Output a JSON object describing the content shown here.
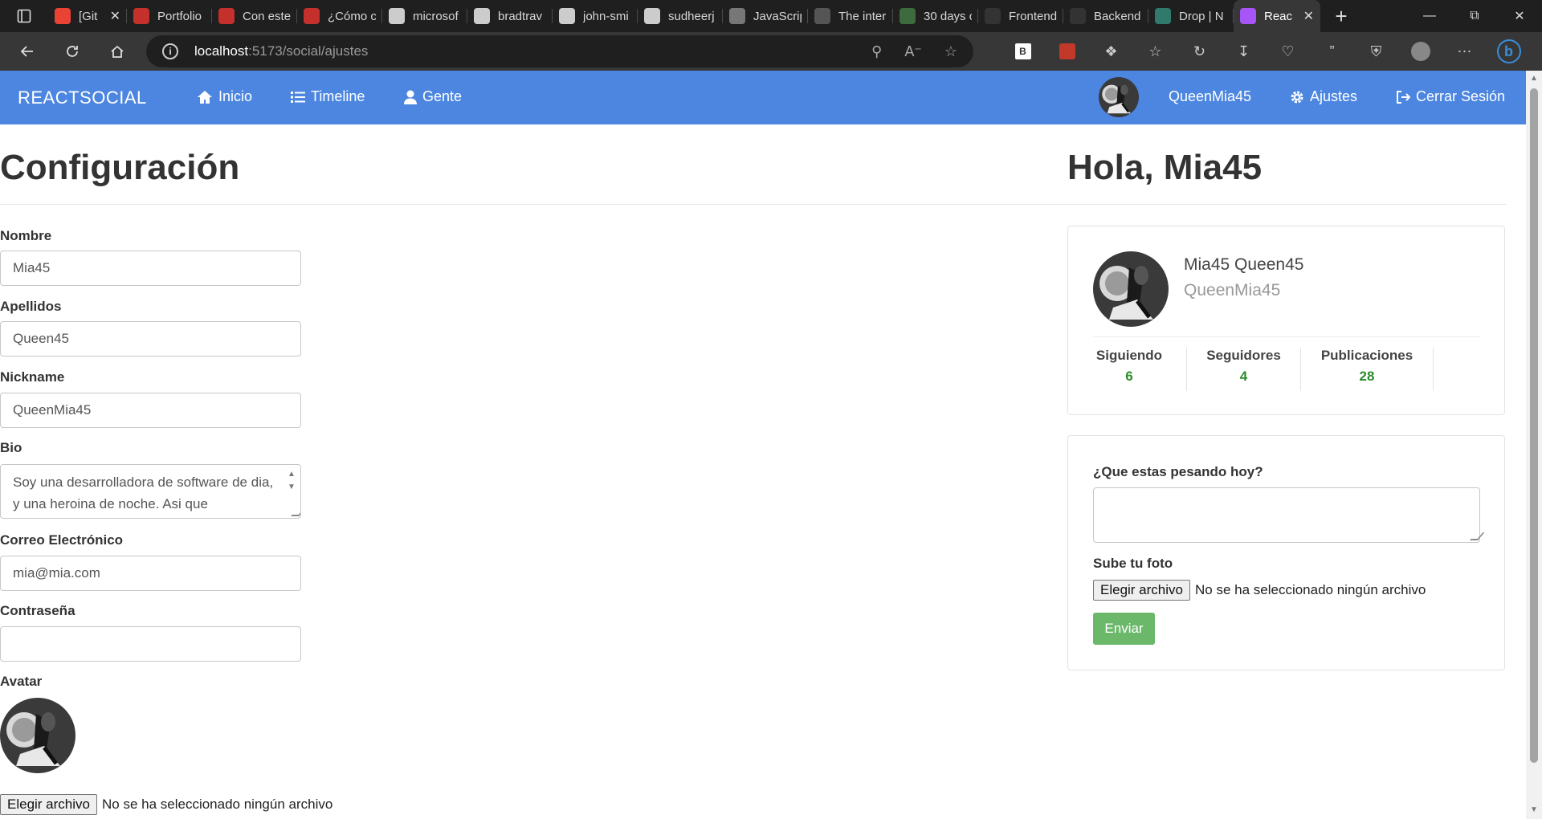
{
  "browser": {
    "tabs": [
      {
        "label": "[Git",
        "icon": "gmail-icon",
        "color": "#ea4335"
      },
      {
        "label": "Portfolio",
        "icon": "youtube-icon",
        "color": "#c4302b"
      },
      {
        "label": "Con este",
        "icon": "youtube-icon",
        "color": "#c4302b"
      },
      {
        "label": "¿Cómo c",
        "icon": "youtube-icon",
        "color": "#c4302b"
      },
      {
        "label": "microsof",
        "icon": "github-icon",
        "color": "#cccccc"
      },
      {
        "label": "bradtrav",
        "icon": "github-icon",
        "color": "#cccccc"
      },
      {
        "label": "john-smi",
        "icon": "github-icon",
        "color": "#cccccc"
      },
      {
        "label": "sudheerj",
        "icon": "github-icon",
        "color": "#cccccc"
      },
      {
        "label": "JavaScrip",
        "icon": "thirty-icon",
        "color": "#777777"
      },
      {
        "label": "The inter",
        "icon": "u-icon",
        "color": "#555555"
      },
      {
        "label": "30 days c",
        "icon": "n-icon",
        "color": "#3d6b3d"
      },
      {
        "label": "Frontend",
        "icon": "r-icon",
        "color": "#333333"
      },
      {
        "label": "Backend",
        "icon": "r-icon",
        "color": "#333333"
      },
      {
        "label": "Drop | N",
        "icon": "drop-icon",
        "color": "#2f7a6a"
      },
      {
        "label": "Reac",
        "icon": "vite-icon",
        "color": "#a855f7"
      }
    ],
    "url_host": "localhost",
    "url_path": ":5173/social/ajustes"
  },
  "nav": {
    "brand": "REACTSOCIAL",
    "inicio": "Inicio",
    "timeline": "Timeline",
    "gente": "Gente",
    "username": "QueenMia45",
    "ajustes": "Ajustes",
    "logout": "Cerrar Sesión"
  },
  "settings": {
    "title": "Configuración",
    "nombre_label": "Nombre",
    "nombre_value": "Mia45",
    "apellidos_label": "Apellidos",
    "apellidos_value": "Queen45",
    "nickname_label": "Nickname",
    "nickname_value": "QueenMia45",
    "bio_label": "Bio",
    "bio_value": "Soy una desarrolladora de software de dia, y una heroina de noche. Asi que",
    "email_label": "Correo Electrónico",
    "email_value": "mia@mia.com",
    "password_label": "Contraseña",
    "password_value": "",
    "avatar_label": "Avatar",
    "file_button": "Elegir archivo",
    "file_status": "No se ha seleccionado ningún archivo"
  },
  "sidebar": {
    "greeting": "Hola, Mia45",
    "full_name": "Mia45 Queen45",
    "nickname": "QueenMia45",
    "stats": [
      {
        "label": "Siguiendo",
        "value": "6"
      },
      {
        "label": "Seguidores",
        "value": "4"
      },
      {
        "label": "Publicaciones",
        "value": "28"
      }
    ],
    "post_label": "¿Que estas pesando hoy?",
    "photo_label": "Sube tu foto",
    "file_button": "Elegir archivo",
    "file_status": "No se ha seleccionado ningún archivo",
    "submit": "Enviar"
  },
  "colors": {
    "navbar": "#4c86e0",
    "stat_number": "#2a8c2a",
    "submit": "#6bb86b"
  }
}
